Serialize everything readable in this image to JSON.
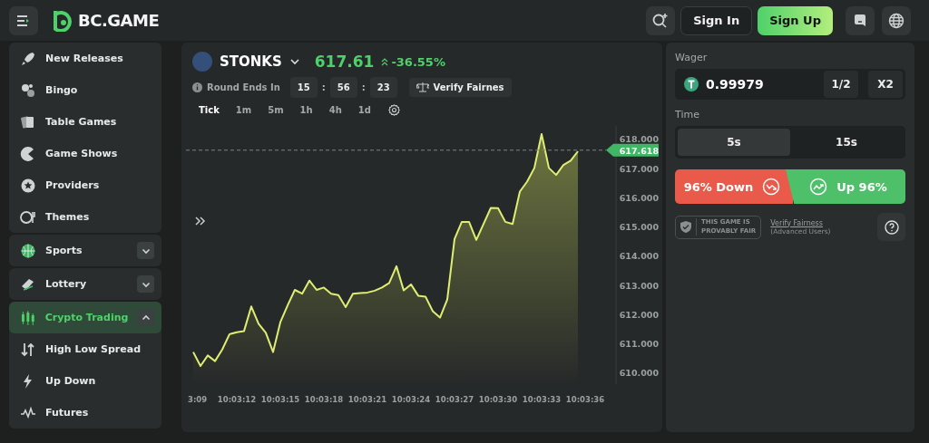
{
  "header": {
    "logo": "BC.GAME",
    "sign_in": "Sign In",
    "sign_up": "Sign Up"
  },
  "sidebar": {
    "items": [
      {
        "label": "New Releases",
        "selected": false
      },
      {
        "label": "Bingo",
        "selected": false
      },
      {
        "label": "Table Games",
        "selected": false
      },
      {
        "label": "Game Shows",
        "selected": false
      },
      {
        "label": "Providers",
        "selected": false
      },
      {
        "label": "Themes",
        "selected": false
      },
      {
        "label": "Sports",
        "selected": false,
        "expanded": false
      },
      {
        "label": "Lottery",
        "selected": false,
        "expanded": false
      },
      {
        "label": "Crypto Trading",
        "selected": true,
        "expanded": true,
        "children": [
          {
            "label": "High Low Spread",
            "selected": false
          },
          {
            "label": "Up Down",
            "selected": false
          },
          {
            "label": "Futures",
            "selected": false
          }
        ]
      }
    ]
  },
  "ticker": {
    "name": "STONKS",
    "price": "617.61",
    "change": "-36.55%",
    "round_label": "Round Ends In",
    "countdown": [
      {
        "kind": "box",
        "text": "15"
      },
      {
        "kind": "sep",
        "text": ":"
      },
      {
        "kind": "box",
        "text": "56"
      },
      {
        "kind": "sep",
        "text": ":"
      },
      {
        "kind": "box",
        "text": "23"
      }
    ],
    "verify": "Verify Fairnes",
    "intervals": [
      {
        "label": "Tick",
        "selected": true
      },
      {
        "label": "1m",
        "selected": false
      },
      {
        "label": "5m",
        "selected": false
      },
      {
        "label": "1h",
        "selected": false
      },
      {
        "label": "4h",
        "selected": false
      },
      {
        "label": "1d",
        "selected": false
      }
    ],
    "chart_data": {
      "type": "area",
      "categories": [
        "3:09",
        null,
        null,
        null,
        null,
        null,
        "10:03:12",
        null,
        null,
        null,
        null,
        null,
        "10:03:15",
        null,
        null,
        null,
        null,
        null,
        "10:03:18",
        null,
        null,
        null,
        null,
        null,
        "10:03:21",
        null,
        null,
        null,
        null,
        null,
        "10:03:24",
        null,
        null,
        null,
        null,
        null,
        "10:03:27",
        null,
        null,
        null,
        null,
        null,
        "10:03:30",
        null,
        null,
        null,
        null,
        null,
        "10:03:33",
        null,
        null,
        null,
        null,
        null,
        "10:03:36"
      ],
      "series": [
        {
          "color": "#dfee72",
          "values": [
            610.7,
            610.22,
            610.58,
            610.39,
            610.79,
            611.31,
            611.38,
            611.42,
            612.26,
            611.67,
            611.36,
            610.7,
            611.72,
            612.3,
            612.83,
            612.7,
            613.15,
            612.83,
            612.91,
            612.7,
            612.65,
            612.24,
            612.7,
            612.72,
            612.74,
            612.8,
            612.91,
            613.07,
            613.64,
            612.81,
            613.02,
            612.63,
            612.6,
            612.1,
            611.88,
            612.5,
            614.57,
            615.16,
            615.16,
            614.54,
            615.09,
            615.64,
            615.63,
            615.16,
            615.09,
            616.2,
            616.54,
            617.01,
            618.17,
            617.01,
            616.77,
            617.11,
            617.26,
            617.58,
            null
          ]
        }
      ],
      "ylim": [
        609.6,
        618.45
      ],
      "ref_lines": [
        {
          "axis": "y",
          "value": 617.618,
          "label": "617.618"
        }
      ],
      "yticks": [
        {
          "value": 618,
          "label": "618.000"
        },
        {
          "value": 617,
          "label": "617.000"
        },
        {
          "value": 616,
          "label": "616.000"
        },
        {
          "value": 615,
          "label": "615.000"
        },
        {
          "value": 614,
          "label": "614.000"
        },
        {
          "value": 613,
          "label": "613.000"
        },
        {
          "value": 612,
          "label": "612.000"
        },
        {
          "value": 611,
          "label": "611.000"
        },
        {
          "value": 610,
          "label": "610.000"
        }
      ]
    }
  },
  "bet": {
    "wager_label": "Wager",
    "wager": "0.99979",
    "half": "1/2",
    "double": "X2",
    "time_label": "Time",
    "times": [
      {
        "label": "5s",
        "selected": true
      },
      {
        "label": "15s",
        "selected": false
      }
    ],
    "down": "96% Down",
    "up": "Up 96%",
    "badge": [
      "THIS GAME IS",
      "PROVABLY FAIR"
    ],
    "verify_link": "Verify Fairness",
    "verify_note": "(Advanced Users)"
  }
}
